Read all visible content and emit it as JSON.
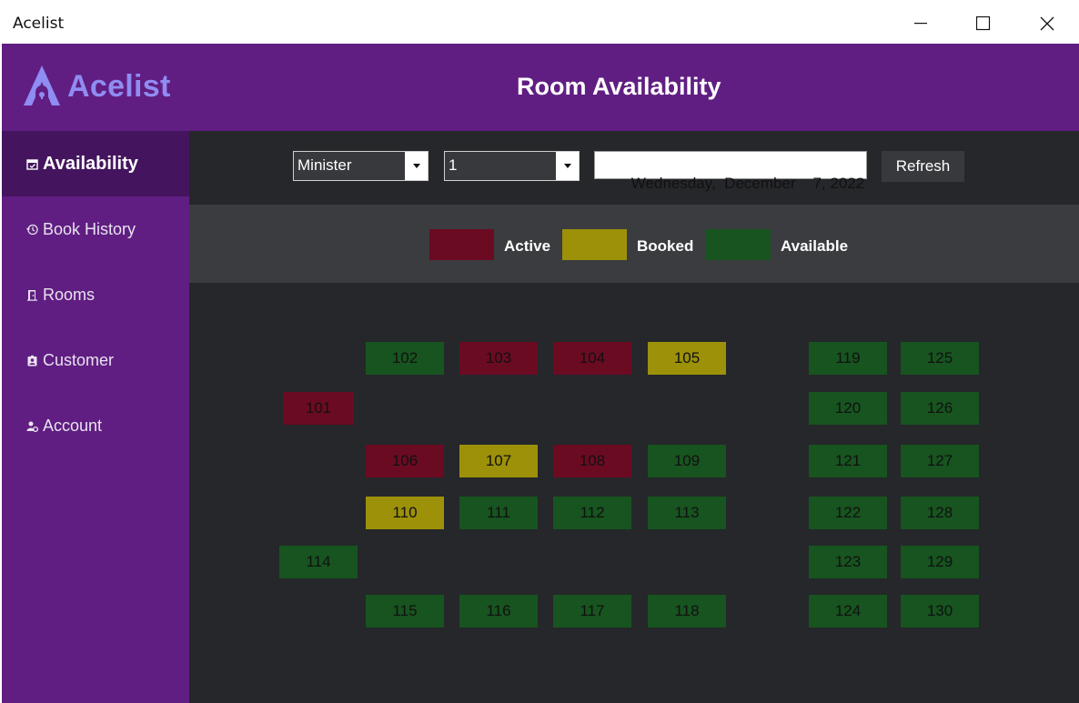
{
  "window": {
    "title": "Acelist"
  },
  "header": {
    "logo_text": "Acelist",
    "title": "Room Availability"
  },
  "sidebar": {
    "items": [
      {
        "label": "Availability",
        "icon": "calendar-check-icon",
        "active": true
      },
      {
        "label": "Book History",
        "icon": "history-icon",
        "active": false
      },
      {
        "label": "Rooms",
        "icon": "door-icon",
        "active": false
      },
      {
        "label": "Customer",
        "icon": "badge-icon",
        "active": false
      },
      {
        "label": "Account",
        "icon": "user-gear-icon",
        "active": false
      }
    ]
  },
  "toolbar": {
    "room_type": "Minister",
    "floor": "1",
    "date": "Wednesday,  December    7, 2022",
    "refresh_label": "Refresh"
  },
  "legend": {
    "active": "Active",
    "booked": "Booked",
    "available": "Available"
  },
  "colors": {
    "header": "#601e82",
    "active": "#6b0b22",
    "booked": "#9c9109",
    "available": "#17541f",
    "logo": "#8f8cf2"
  },
  "rooms": [
    {
      "number": "101",
      "status": "active"
    },
    {
      "number": "102",
      "status": "available"
    },
    {
      "number": "103",
      "status": "active"
    },
    {
      "number": "104",
      "status": "active"
    },
    {
      "number": "105",
      "status": "booked"
    },
    {
      "number": "106",
      "status": "active"
    },
    {
      "number": "107",
      "status": "booked"
    },
    {
      "number": "108",
      "status": "active"
    },
    {
      "number": "109",
      "status": "available"
    },
    {
      "number": "110",
      "status": "booked"
    },
    {
      "number": "111",
      "status": "available"
    },
    {
      "number": "112",
      "status": "available"
    },
    {
      "number": "113",
      "status": "available"
    },
    {
      "number": "114",
      "status": "available"
    },
    {
      "number": "115",
      "status": "available"
    },
    {
      "number": "116",
      "status": "available"
    },
    {
      "number": "117",
      "status": "available"
    },
    {
      "number": "118",
      "status": "available"
    },
    {
      "number": "119",
      "status": "available"
    },
    {
      "number": "120",
      "status": "available"
    },
    {
      "number": "121",
      "status": "available"
    },
    {
      "number": "122",
      "status": "available"
    },
    {
      "number": "123",
      "status": "available"
    },
    {
      "number": "124",
      "status": "available"
    },
    {
      "number": "125",
      "status": "available"
    },
    {
      "number": "126",
      "status": "available"
    },
    {
      "number": "127",
      "status": "available"
    },
    {
      "number": "128",
      "status": "available"
    },
    {
      "number": "129",
      "status": "available"
    },
    {
      "number": "130",
      "status": "available"
    }
  ]
}
